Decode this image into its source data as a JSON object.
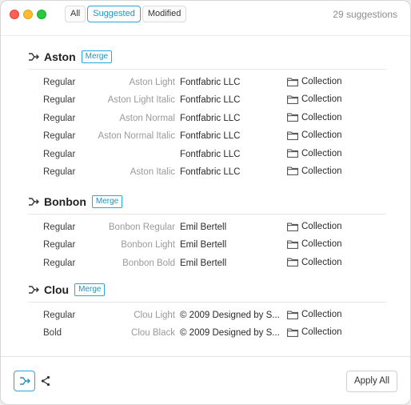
{
  "filters": [
    {
      "label": "All",
      "active": false
    },
    {
      "label": "Suggested",
      "active": true
    },
    {
      "label": "Modified",
      "active": false
    }
  ],
  "suggestion_count": "29 suggestions",
  "merge_label": "Merge",
  "collection_label": "Collection",
  "groups": [
    {
      "name": "Aston",
      "rows": [
        {
          "style": "Regular",
          "name": "Aston Light",
          "foundry": "Fontfabric LLC"
        },
        {
          "style": "Regular",
          "name": "Aston Light Italic",
          "foundry": "Fontfabric LLC"
        },
        {
          "style": "Regular",
          "name": "Aston Normal",
          "foundry": "Fontfabric LLC"
        },
        {
          "style": "Regular",
          "name": "Aston Normal Italic",
          "foundry": "Fontfabric LLC"
        },
        {
          "style": "Regular",
          "name": "",
          "foundry": "Fontfabric LLC"
        },
        {
          "style": "Regular",
          "name": "Aston Italic",
          "foundry": "Fontfabric LLC"
        }
      ]
    },
    {
      "name": "Bonbon",
      "rows": [
        {
          "style": "Regular",
          "name": "Bonbon Regular",
          "foundry": "Emil Bertell"
        },
        {
          "style": "Regular",
          "name": "Bonbon Light",
          "foundry": "Emil Bertell"
        },
        {
          "style": "Regular",
          "name": "Bonbon Bold",
          "foundry": "Emil Bertell"
        }
      ]
    },
    {
      "name": "Clou",
      "rows": [
        {
          "style": "Regular",
          "name": "Clou Light",
          "foundry": "© 2009 Designed by S..."
        },
        {
          "style": "Bold",
          "name": "Clou Black",
          "foundry": "© 2009 Designed by S..."
        }
      ]
    }
  ],
  "footer": {
    "apply_all": "Apply All"
  },
  "icons": {
    "merge": "merge-icon",
    "share": "share-icon",
    "folder": "folder-icon"
  },
  "colors": {
    "accent": "#2aa7d9",
    "close": "#fe5f57",
    "minimize": "#febc2e",
    "maximize": "#28c840"
  }
}
